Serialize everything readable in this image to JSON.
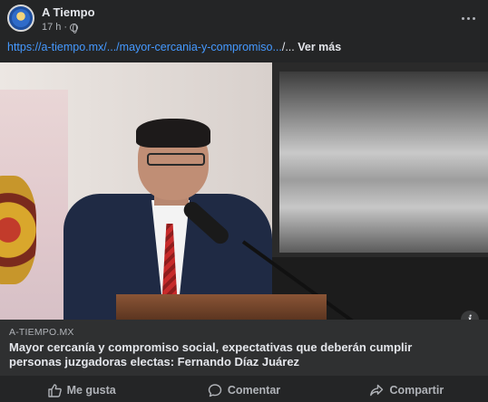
{
  "post": {
    "page_name": "A Tiempo",
    "time": "17 h",
    "separator": "·",
    "link_text": "https://a-tiempo.mx/.../mayor-cercania-y-compromiso...",
    "link_suffix": "/...",
    "see_more": "Ver más"
  },
  "preview": {
    "domain": "A-TIEMPO.MX",
    "headline": "Mayor cercanía y compromiso social, expectativas que deberán cumplir personas juzgadoras electas: Fernando Díaz Juárez"
  },
  "actions": {
    "like": "Me gusta",
    "comment": "Comentar",
    "share": "Compartir"
  },
  "colors": {
    "background": "#242526",
    "link": "#4599ff",
    "text": "#e4e6eb",
    "muted": "#b0b3b8"
  },
  "icons": [
    "globe-icon",
    "more-icon",
    "info-icon",
    "like-icon",
    "comment-icon",
    "share-icon"
  ]
}
